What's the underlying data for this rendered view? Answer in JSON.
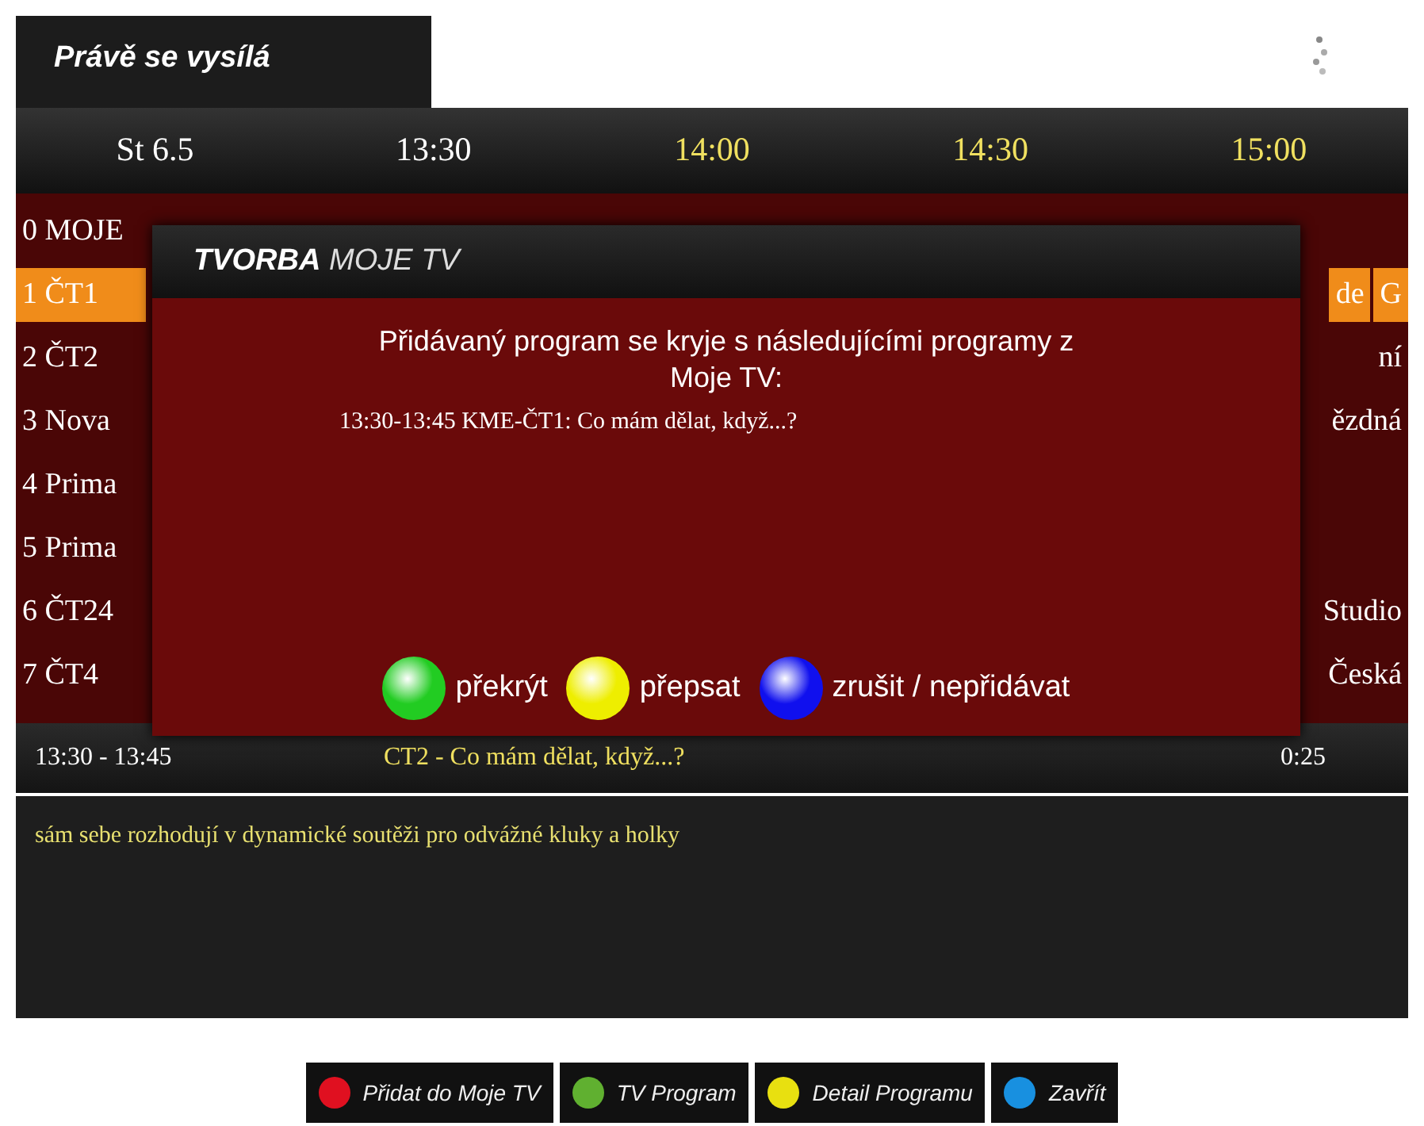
{
  "tab": {
    "label": "Právě se vysílá"
  },
  "timeline": [
    {
      "label": "St 6.5",
      "highlighted": false
    },
    {
      "label": "13:30",
      "highlighted": false
    },
    {
      "label": "14:00",
      "highlighted": true
    },
    {
      "label": "14:30",
      "highlighted": true
    },
    {
      "label": "15:00",
      "highlighted": true
    }
  ],
  "channels": [
    {
      "name": "0 MOJE",
      "selected": false
    },
    {
      "name": "1 ČT1",
      "selected": true,
      "cells": [
        "de",
        "G"
      ]
    },
    {
      "name": "2 ČT2",
      "selected": false,
      "cells": [
        "ní"
      ]
    },
    {
      "name": "3 Nova",
      "selected": false,
      "cells": [
        "ězdná"
      ]
    },
    {
      "name": "4 Prima",
      "selected": false
    },
    {
      "name": "5 Prima",
      "selected": false
    },
    {
      "name": "6 ČT24",
      "selected": false,
      "cells": [
        "Studio"
      ]
    },
    {
      "name": "7 ČT4",
      "selected": false,
      "cells": [
        "Česká"
      ]
    }
  ],
  "dialog": {
    "title": "**TVORBA** MOJE TV",
    "message": "Přidávaný program se kryje s následujícími programy z Moje TV:",
    "conflict": "13:30-13:45 KME-ČT1: Co mám dělat, když...?",
    "options": [
      {
        "label": "překrýt",
        "color": "#22cc22"
      },
      {
        "label": "přepsat",
        "color": "#eeee00"
      },
      {
        "label": "zrušit / nepřidávat",
        "color": "#1010ee"
      }
    ]
  },
  "info": {
    "time": "13:30 - 13:45",
    "title": "CT2 - Co mám dělat, když...?",
    "duration": "0:25",
    "description": "sám sebe rozhodují v dynamické soutěži pro odvážné kluky a holky"
  },
  "footer": [
    {
      "label": "Přidat do Moje TV",
      "color": "#e01020"
    },
    {
      "label": "TV Program",
      "color": "#60b030"
    },
    {
      "label": "Detail Programu",
      "color": "#e8e010"
    },
    {
      "label": "Zavřít",
      "color": "#1890e0"
    }
  ]
}
